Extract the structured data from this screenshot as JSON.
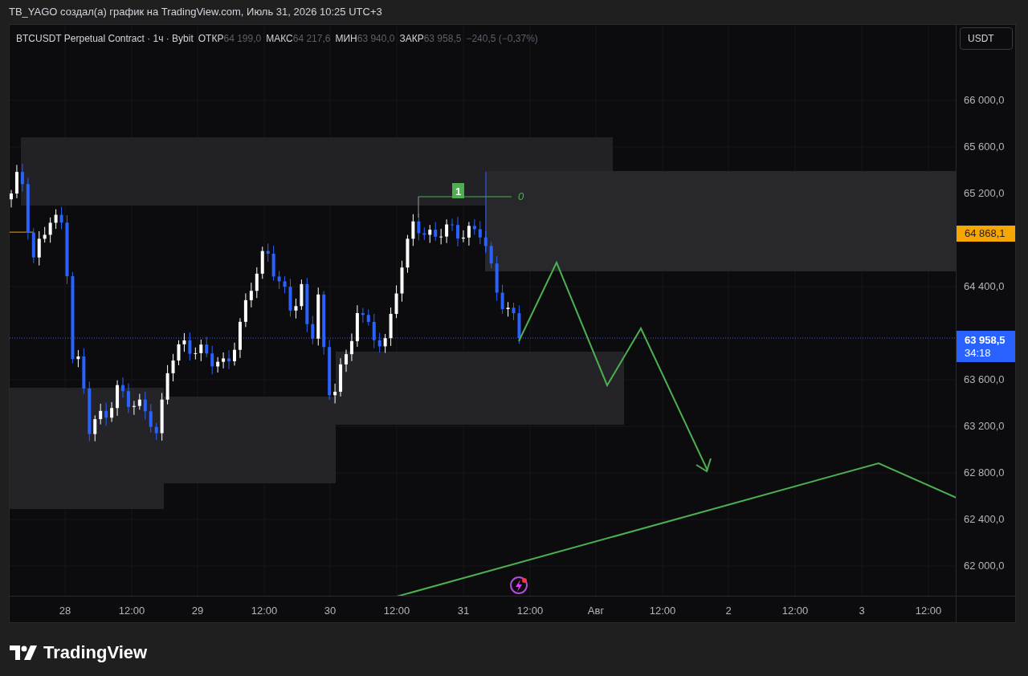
{
  "header": {
    "title": "TB_YAGO создал(а) график на TradingView.com, Июль 31, 2026 10:25 UTC+3"
  },
  "legend": {
    "symbol": "BTCUSDT Perpetual Contract · 1ч · Bybit",
    "fields": [
      {
        "label": "ОТКР",
        "value": "64 199,0"
      },
      {
        "label": "МАКС",
        "value": "64 217,6"
      },
      {
        "label": "МИН",
        "value": "63 940,0"
      },
      {
        "label": "ЗАКР",
        "value": "63 958,5"
      }
    ],
    "change": "−240,5 (−0,37%)"
  },
  "currency_button": "USDT",
  "price_axis": {
    "ticks": [
      "66 000,0",
      "65 600,0",
      "65 200,0",
      "64 400,0",
      "63 600,0",
      "63 200,0",
      "62 800,0",
      "62 400,0",
      "62 000,0"
    ],
    "marker_price": "64 868,1",
    "last_price": "63 958,5",
    "countdown": "34:18"
  },
  "drawings": {
    "marker_label": "1",
    "level_label": "0"
  },
  "time_axis": [
    "28",
    "12:00",
    "29",
    "12:00",
    "30",
    "12:00",
    "31",
    "12:00",
    "Авг",
    "12:00",
    "2",
    "12:00",
    "3",
    "12:00"
  ],
  "logo": "TradingView"
}
